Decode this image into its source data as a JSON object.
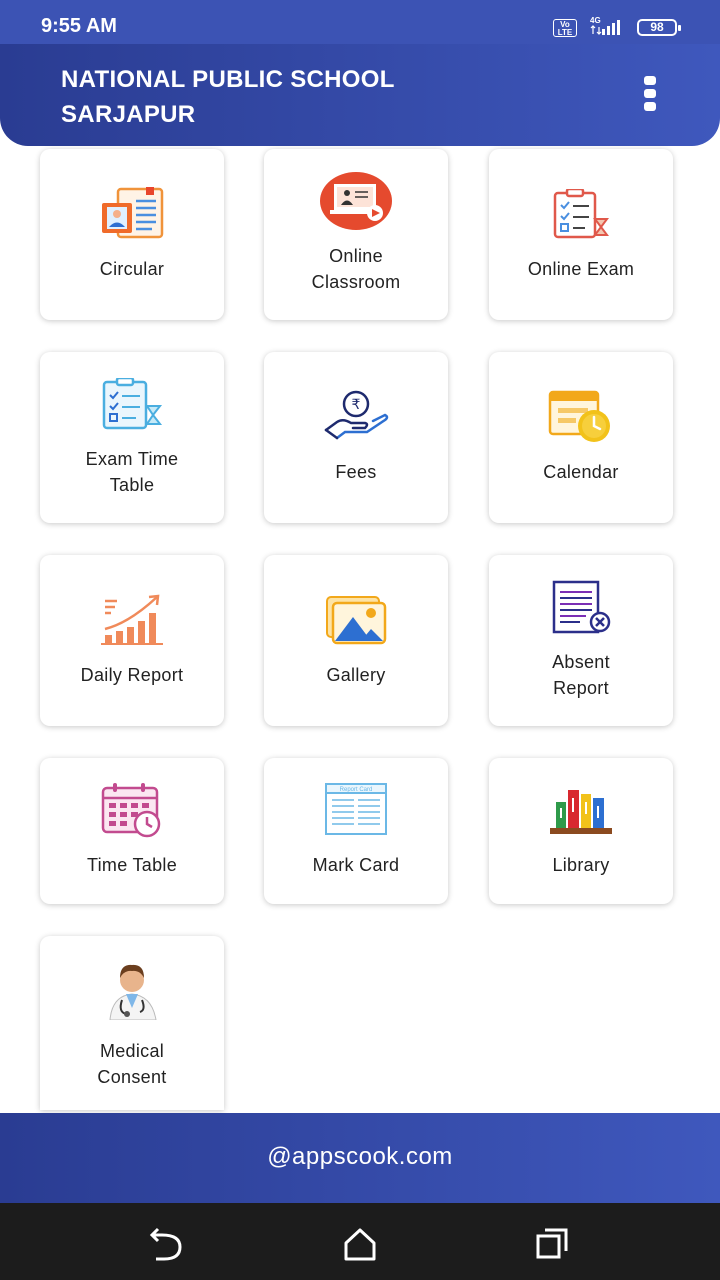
{
  "status_bar": {
    "time": "9:55 AM",
    "volte": "Vo LTE",
    "network": "4G",
    "battery": "98"
  },
  "header": {
    "title_line1": "NATIONAL PUBLIC SCHOOL",
    "title_line2": "SARJAPUR",
    "menu_icon": "more-vertical-icon"
  },
  "tiles": [
    {
      "label1": "Circular",
      "label2": "",
      "icon": "circular-icon"
    },
    {
      "label1": "Online",
      "label2": "Classroom",
      "icon": "online-classroom-icon"
    },
    {
      "label1": "Online Exam",
      "label2": "",
      "icon": "online-exam-icon"
    },
    {
      "label1": "Exam Time",
      "label2": "Table",
      "icon": "exam-timetable-icon"
    },
    {
      "label1": "Fees",
      "label2": "",
      "icon": "fees-icon"
    },
    {
      "label1": "Calendar",
      "label2": "",
      "icon": "calendar-icon"
    },
    {
      "label1": "Daily Report",
      "label2": "",
      "icon": "daily-report-icon"
    },
    {
      "label1": "Gallery",
      "label2": "",
      "icon": "gallery-icon"
    },
    {
      "label1": "Absent",
      "label2": "Report",
      "icon": "absent-report-icon"
    },
    {
      "label1": "Time Table",
      "label2": "",
      "icon": "time-table-icon"
    },
    {
      "label1": "Mark Card",
      "label2": "",
      "icon": "mark-card-icon",
      "card_text": "Report Card"
    },
    {
      "label1": "Library",
      "label2": "",
      "icon": "library-icon"
    },
    {
      "label1": "Medical",
      "label2": "Consent",
      "icon": "medical-consent-icon"
    }
  ],
  "footer": {
    "text": "@appscook.com"
  },
  "nav_bar": {
    "back": "back-icon",
    "home": "home-icon",
    "recents": "recents-icon"
  },
  "colors": {
    "primary": "#3c53b4",
    "primary_dark": "#2a3c92",
    "nav_bar": "#1c1c1c"
  }
}
